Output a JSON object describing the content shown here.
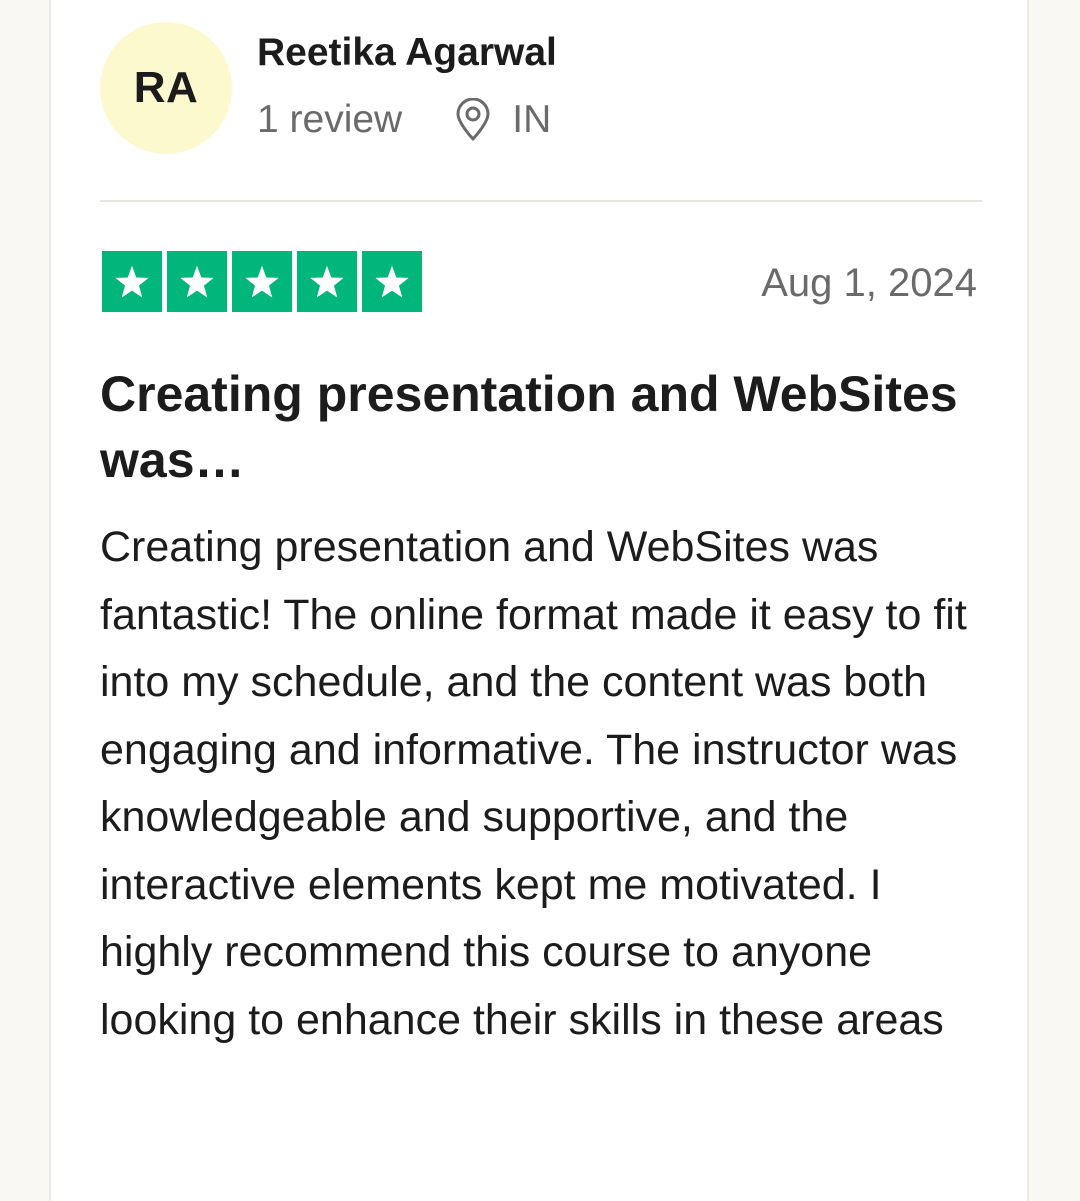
{
  "reviewer": {
    "initials": "RA",
    "name": "Reetika Agarwal",
    "review_count": "1 review",
    "location_icon": "map-pin-icon",
    "country": "IN"
  },
  "review": {
    "rating": 5,
    "rating_max": 5,
    "star_color": "#00b67a",
    "date": "Aug 1, 2024",
    "title": "Creating presentation and WebSites was…",
    "body": "Creating presentation and WebSites was fantastic! The online format made it easy to fit into my schedule, and the content was both engaging and informative. The instructor was knowledgeable and supportive, and the interactive elements kept me motivated. I highly recommend this course to anyone looking to enhance their skills in these areas"
  },
  "colors": {
    "avatar_bg": "#fcf9cf",
    "muted_text": "#6a6a6a"
  }
}
